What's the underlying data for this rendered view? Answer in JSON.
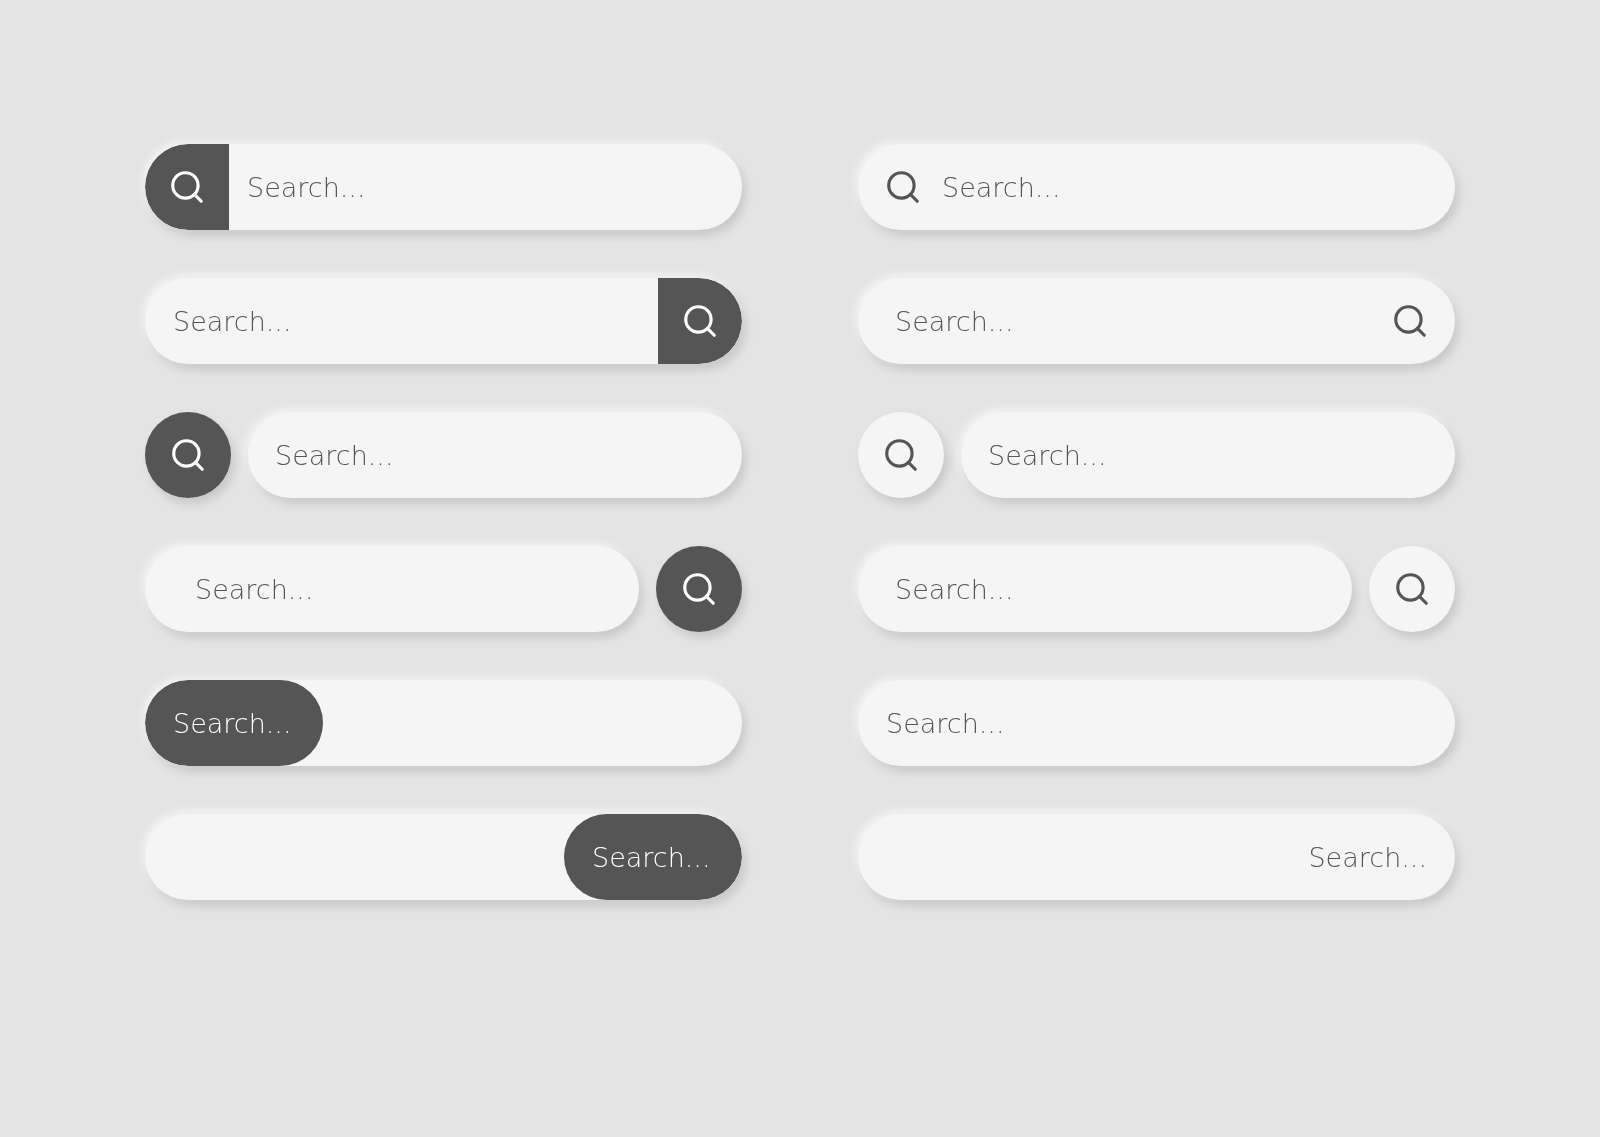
{
  "columns": [
    {
      "bars": [
        {
          "kind": "icon-left-dark",
          "placeholder": "Search..."
        },
        {
          "kind": "icon-right-dark",
          "placeholder": "Search..."
        },
        {
          "kind": "circle-left-dark",
          "placeholder": "Search..."
        },
        {
          "kind": "circle-right-dark",
          "placeholder": "Search..."
        },
        {
          "kind": "pill-left-dark",
          "label": "Search..."
        },
        {
          "kind": "pill-right-dark",
          "label": "Search..."
        }
      ]
    },
    {
      "bars": [
        {
          "kind": "icon-left-plain",
          "placeholder": "Search..."
        },
        {
          "kind": "icon-right-plain",
          "placeholder": "Search..."
        },
        {
          "kind": "circle-left-light",
          "placeholder": "Search..."
        },
        {
          "kind": "circle-right-light",
          "placeholder": "Search..."
        },
        {
          "kind": "text-left",
          "placeholder": "Search..."
        },
        {
          "kind": "text-right",
          "placeholder": "Search..."
        }
      ]
    }
  ]
}
